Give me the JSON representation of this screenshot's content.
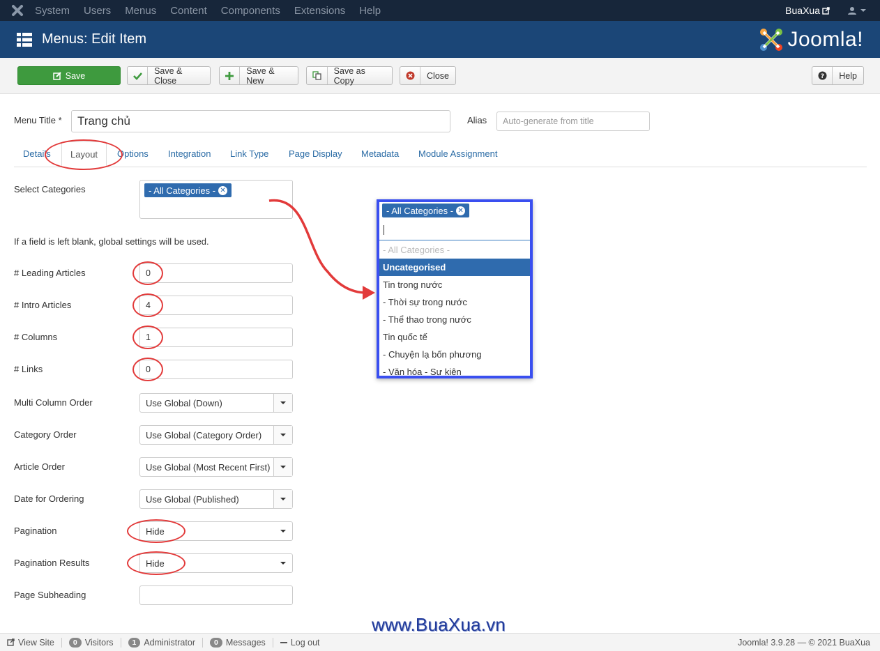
{
  "topnav": {
    "menu": [
      "System",
      "Users",
      "Menus",
      "Content",
      "Components",
      "Extensions",
      "Help"
    ],
    "site_name": "BuaXua"
  },
  "header": {
    "title": "Menus: Edit Item",
    "brand": "Joomla!"
  },
  "toolbar": {
    "save": "Save",
    "save_close": "Save & Close",
    "save_new": "Save & New",
    "save_copy": "Save as Copy",
    "close": "Close",
    "help": "Help"
  },
  "form": {
    "menu_title_label": "Menu Title *",
    "menu_title_value": "Trang chủ",
    "alias_label": "Alias",
    "alias_placeholder": "Auto-generate from title"
  },
  "tabs": [
    "Details",
    "Layout",
    "Options",
    "Integration",
    "Link Type",
    "Page Display",
    "Metadata",
    "Module Assignment"
  ],
  "layout": {
    "select_categories_label": "Select Categories",
    "selected_category": "- All Categories -",
    "hint": "If a field is left blank, global settings will be used.",
    "leading_label": "# Leading Articles",
    "leading_value": "0",
    "intro_label": "# Intro Articles",
    "intro_value": "4",
    "columns_label": "# Columns",
    "columns_value": "1",
    "links_label": "# Links",
    "links_value": "0",
    "multi_column_label": "Multi Column Order",
    "multi_column_value": "Use Global (Down)",
    "category_order_label": "Category Order",
    "category_order_value": "Use Global (Category Order)",
    "article_order_label": "Article Order",
    "article_order_value": "Use Global (Most Recent First)",
    "date_ordering_label": "Date for Ordering",
    "date_ordering_value": "Use Global (Published)",
    "pagination_label": "Pagination",
    "pagination_value": "Hide",
    "pagination_results_label": "Pagination Results",
    "pagination_results_value": "Hide",
    "subheading_label": "Page Subheading",
    "subheading_value": ""
  },
  "dropdown": {
    "chip": "- All Categories -",
    "options": [
      "- All Categories -",
      "Uncategorised",
      "Tin trong nước",
      "- Thời sự trong nước",
      "- Thể thao trong nước",
      "Tin quốc tế",
      "- Chuyện lạ bốn phương",
      "- Văn hóa - Sự kiện"
    ]
  },
  "watermark": "www.BuaXua.vn",
  "status": {
    "view_site": "View Site",
    "visitors_count": "0",
    "visitors": "Visitors",
    "admin_count": "1",
    "admin": "Administrator",
    "messages_count": "0",
    "messages": "Messages",
    "logout": "Log out",
    "version": "Joomla! 3.9.28 — © 2021 BuaXua"
  },
  "colors": {
    "topnav": "#17263a",
    "header": "#1b4677",
    "save": "#3e9a3e",
    "link": "#2a6ba5",
    "highlight": "#2f6bae",
    "annotation": "#e23a3a",
    "popup_border": "#3a4ff0"
  }
}
